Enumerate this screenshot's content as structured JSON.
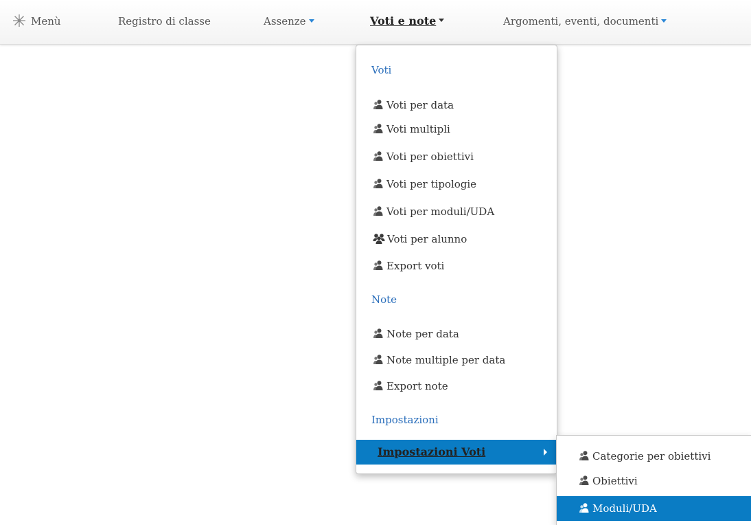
{
  "navbar": {
    "menu_label": "Menù",
    "registro_label": "Registro di classe",
    "assenze_label": "Assenze",
    "voti_note_label": "Voti e note",
    "argomenti_label": "Argomenti, eventi, documenti"
  },
  "dropdown": {
    "voti_header": "Voti",
    "voti_items": [
      {
        "label": "Voti per data",
        "icon": "user-icon"
      },
      {
        "label": "Voti multipli",
        "icon": "user-icon"
      },
      {
        "label": "Voti per obiettivi",
        "icon": "user-icon"
      },
      {
        "label": "Voti per tipologie",
        "icon": "user-icon"
      },
      {
        "label": "Voti per moduli/UDA",
        "icon": "user-icon"
      },
      {
        "label": "Voti per alunno",
        "icon": "group-icon"
      },
      {
        "label": "Export voti",
        "icon": "user-icon"
      }
    ],
    "note_header": "Note",
    "note_items": [
      {
        "label": "Note per data",
        "icon": "user-icon"
      },
      {
        "label": "Note multiple per data",
        "icon": "user-icon"
      },
      {
        "label": "Export note",
        "icon": "user-icon"
      }
    ],
    "impostazioni_header": "Impostazioni",
    "impostazioni_voti_label": "Impostazioni Voti"
  },
  "submenu": {
    "items": [
      {
        "label": "Categorie per obiettivi",
        "icon": "user-icon"
      },
      {
        "label": "Obiettivi",
        "icon": "user-icon"
      },
      {
        "label": "Moduli/UDA",
        "icon": "user-icon",
        "selected": true
      }
    ]
  },
  "colors": {
    "accent": "#0a7cc4",
    "section_header": "#2a6ebb",
    "caret": "#2a86d6"
  }
}
